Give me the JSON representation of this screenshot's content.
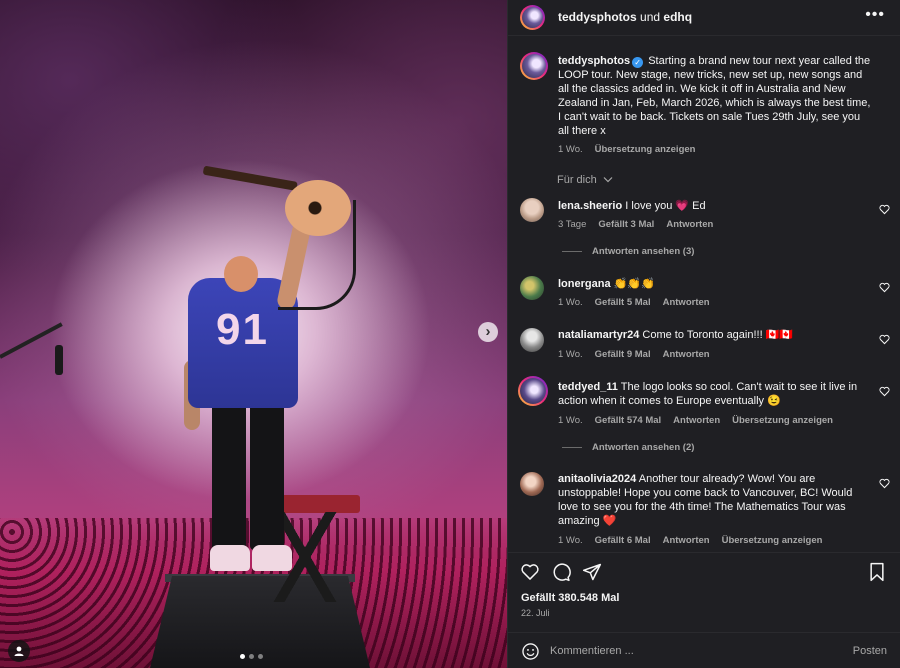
{
  "header": {
    "author": "teddysphotos",
    "connector": "und",
    "coauthor": "edhq",
    "more_label": "•••"
  },
  "caption": {
    "username": "teddysphotos",
    "text": "Starting a brand new tour next year called the LOOP tour. New stage, new tricks, new set up, new songs and all the classics added in. We kick it off in Australia and New Zealand in Jan, Feb, March 2026, which is always the best time, I can't wait to be back. Tickets on sale Tues 29th July, see you all there x",
    "time": "1 Wo.",
    "translate": "Übersetzung anzeigen"
  },
  "for_you": "Für dich",
  "media": {
    "jersey_number": "91",
    "next_glyph": "›",
    "slide_count": 3,
    "active_slide": 1
  },
  "comments": [
    {
      "username": "lena.sheerio",
      "text": "I love you 💗 Ed",
      "time": "3 Tage",
      "likes": "Gefällt 3 Mal",
      "reply": "Antworten",
      "translate": ""
    },
    {
      "username": "lonergana",
      "text": "👏👏👏",
      "time": "1 Wo.",
      "likes": "Gefällt 5 Mal",
      "reply": "Antworten",
      "translate": ""
    },
    {
      "username": "nataliamartyr24",
      "text": "Come to Toronto again!!! 🇨🇦🇨🇦",
      "time": "1 Wo.",
      "likes": "Gefällt 9 Mal",
      "reply": "Antworten",
      "translate": ""
    },
    {
      "username": "teddyed_11",
      "text": "The logo looks so cool. Can't wait to see it live in action when it comes to Europe eventually 😉",
      "time": "1 Wo.",
      "likes": "Gefällt 574 Mal",
      "reply": "Antworten",
      "translate": "Übersetzung anzeigen"
    },
    {
      "username": "anitaolivia2024",
      "text": "Another tour already? Wow! You are unstoppable! Hope you come back to Vancouver, BC! Would love to see you for the 4th time! The Mathematics Tour was amazing ❤️",
      "time": "1 Wo.",
      "likes": "Gefällt 6 Mal",
      "reply": "Antworten",
      "translate": "Übersetzung anzeigen"
    }
  ],
  "view_replies": [
    "Antworten ansehen (3)",
    "Antworten ansehen (2)"
  ],
  "footer": {
    "likes": "Gefällt 380.548 Mal",
    "date": "22. Juli",
    "comment_placeholder": "Kommentieren ...",
    "post_label": "Posten"
  },
  "icons": {
    "like": "heart-icon",
    "comment": "comment-icon",
    "share": "share-icon",
    "save": "bookmark-icon",
    "emoji": "emoji-icon",
    "tag": "user-tag-icon"
  },
  "colors": {
    "panel_bg": "#1f1f23",
    "verified": "#3897f0",
    "muted_text": "#a8a8a8"
  }
}
